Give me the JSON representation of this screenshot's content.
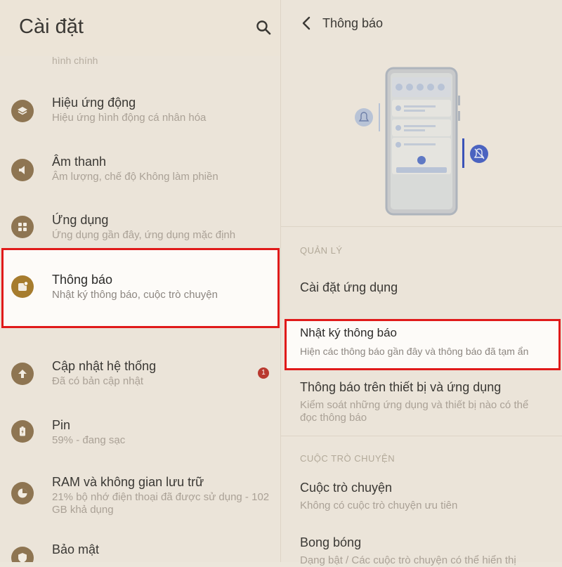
{
  "left": {
    "title": "Cài đặt",
    "partial_text": "hình chính",
    "items": [
      {
        "title": "Hiệu ứng động",
        "subtitle": "Hiệu ứng hình động cá nhân hóa",
        "icon": "layers-icon"
      },
      {
        "title": "Âm thanh",
        "subtitle": "Âm lượng, chế độ Không làm phiền",
        "icon": "speaker-icon"
      },
      {
        "title": "Ứng dụng",
        "subtitle": "Ứng dụng gần đây, ứng dụng mặc định",
        "icon": "apps-grid-icon"
      },
      {
        "title": "Thông báo",
        "subtitle": "Nhật ký thông báo, cuộc trò chuyện",
        "icon": "notification-icon"
      },
      {
        "title": "Cập nhật hệ thống",
        "subtitle": "Đã có bản cập nhật",
        "icon": "system-update-icon",
        "badge": "1"
      },
      {
        "title": "Pin",
        "subtitle": "59% - đang sạc",
        "icon": "battery-icon"
      },
      {
        "title": "RAM và không gian lưu trữ",
        "subtitle": "21% bộ nhớ điện thoại đã được sử dụng - 102 GB khả dụng",
        "icon": "storage-icon"
      },
      {
        "title": "Bảo mật",
        "subtitle": "",
        "icon": "shield-icon"
      }
    ]
  },
  "right": {
    "title": "Thông báo",
    "sections": [
      {
        "header": "QUẢN LÝ",
        "items": [
          {
            "title": "Cài đặt ứng dụng",
            "subtitle": ""
          },
          {
            "title": "Nhật ký thông báo",
            "subtitle": "Hiện các thông báo gần đây và thông báo đã tạm ẩn"
          },
          {
            "title": "Thông báo trên thiết bị và ứng dụng",
            "subtitle": "Kiểm soát những ứng dụng và thiết bị nào có thể đọc thông báo"
          }
        ]
      },
      {
        "header": "CUỘC TRÒ CHUYỆN",
        "items": [
          {
            "title": "Cuộc trò chuyện",
            "subtitle": "Không có cuộc trò chuyện ưu tiên"
          },
          {
            "title": "Bong bóng",
            "subtitle": "Dạng bật / Các cuộc trò chuyện có thể hiển thị"
          }
        ]
      }
    ]
  },
  "colors": {
    "highlight_border": "#e01a1a",
    "icon_brown": "#8e7552",
    "badge_red": "#b9392f",
    "accent_blue": "#3b53b8"
  }
}
